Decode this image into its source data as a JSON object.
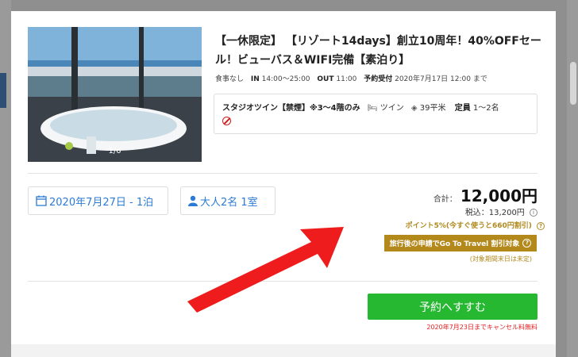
{
  "listing": {
    "title": "【一休限定】 【リゾート14days】創立10周年！40%OFFセール！ビューバス＆WIFI完備【素泊り】",
    "meal": "食事なし",
    "checkin_label": "IN",
    "checkin": "14:00～25:00",
    "checkout_label": "OUT",
    "checkout": "11:00",
    "booking_label": "予約受付",
    "booking_deadline": "2020年7月17日 12:00 まで",
    "photo_counter": "1/6"
  },
  "room": {
    "name": "スタジオツイン【禁煙】※3～4階のみ",
    "bed": "ツイン",
    "size": "39平米",
    "capacity_label": "定員",
    "capacity": "1～2名"
  },
  "search": {
    "date": "2020年7月27日 - 1泊",
    "guests": "大人2名 1室"
  },
  "price": {
    "total_label": "合計：",
    "total": "12,000円",
    "tax_incl": "税込：13,200円",
    "points": "ポイント5%(今すぐ使うと660円割引)",
    "go_to_travel": "旅行後の申請でGo To Travel 割引対象",
    "note": "(対象期間末日は未定)"
  },
  "actions": {
    "reserve": "予約へすすむ",
    "cancel_note": "2020年7月23日までキャンセル料無料"
  },
  "colors": {
    "accent_blue": "#2b7bd6",
    "gold": "#b3891c",
    "green": "#27b832",
    "red": "#e02020"
  }
}
